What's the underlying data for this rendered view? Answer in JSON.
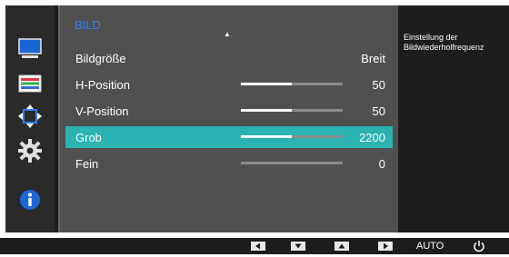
{
  "menu": {
    "title": "BILD",
    "items": [
      {
        "label": "Bildgröße",
        "value": "Breit",
        "level": null,
        "selected": false
      },
      {
        "label": "H-Position",
        "value": "50",
        "level": 0.5,
        "selected": false
      },
      {
        "label": "V-Position",
        "value": "50",
        "level": 0.5,
        "selected": false
      },
      {
        "label": "Grob",
        "value": "2200",
        "level": 0.5,
        "selected": true
      },
      {
        "label": "Fein",
        "value": "0",
        "level": 0.0,
        "selected": false
      }
    ]
  },
  "sidebar": {
    "icons": [
      "monitor-picture-icon",
      "color-icon",
      "size-position-icon",
      "settings-gear-icon",
      "info-icon"
    ]
  },
  "info": {
    "lines": [
      "Einstellung der",
      "Bildwiederholfrequenz"
    ]
  },
  "controls": {
    "buttons": [
      "left-arrow-button",
      "down-arrow-button",
      "up-arrow-button",
      "right-arrow-button"
    ],
    "auto_label": "AUTO"
  },
  "colors": {
    "accent_blue": "#2f7fff",
    "selected_row": "#2bb2b2",
    "panel": "#505050",
    "background": "#1d1d1d"
  }
}
